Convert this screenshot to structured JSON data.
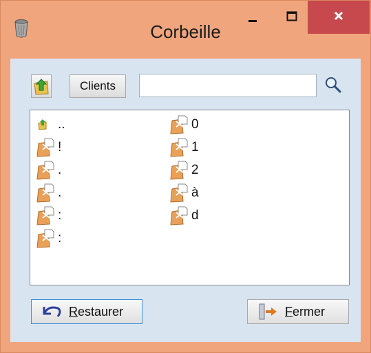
{
  "window": {
    "title": "Corbeille",
    "app_icon": "recycle-bin-icon",
    "colors": {
      "frame": "#f0a57d",
      "close": "#c7494d",
      "client": "#d9e4f1"
    }
  },
  "toolbar": {
    "up_icon": "folder-up-icon",
    "clients_label": "Clients",
    "search_value": "",
    "search_icon": "magnifier-icon"
  },
  "items": [
    {
      "name": "..",
      "icon": "folder-up-small-icon"
    },
    {
      "name": "!",
      "icon": "deleted-file-icon"
    },
    {
      "name": ".",
      "icon": "deleted-file-icon"
    },
    {
      "name": ".",
      "icon": "deleted-file-icon"
    },
    {
      "name": ":",
      "icon": "deleted-file-icon"
    },
    {
      "name": ":",
      "icon": "deleted-file-icon"
    },
    {
      "name": "0",
      "icon": "deleted-file-icon"
    },
    {
      "name": "1",
      "icon": "deleted-file-icon"
    },
    {
      "name": "2",
      "icon": "deleted-file-icon"
    },
    {
      "name": "à",
      "icon": "deleted-file-icon"
    },
    {
      "name": "d",
      "icon": "deleted-file-icon"
    }
  ],
  "buttons": {
    "restore_accel": "R",
    "restore_rest": "estaurer",
    "close_accel": "F",
    "close_rest": "ermer"
  }
}
